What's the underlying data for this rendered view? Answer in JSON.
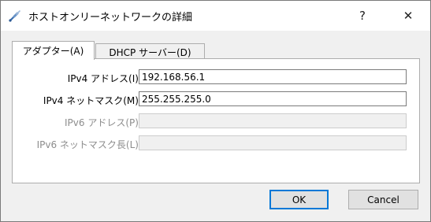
{
  "window": {
    "title": "ホストオンリーネットワークの詳細",
    "help_glyph": "?",
    "close_glyph": "✕",
    "icon": "network-cable-icon"
  },
  "tabs": [
    {
      "label": "アダプター(A)",
      "active": true
    },
    {
      "label": "DHCP サーバー(D)",
      "active": false
    }
  ],
  "fields": {
    "ipv4_address": {
      "label": "IPv4 アドレス(I):",
      "value": "192.168.56.1",
      "enabled": true
    },
    "ipv4_netmask": {
      "label": "IPv4 ネットマスク(M):",
      "value": "255.255.255.0",
      "enabled": true
    },
    "ipv6_address": {
      "label": "IPv6 アドレス(P):",
      "value": "",
      "enabled": false
    },
    "ipv6_prefix": {
      "label": "IPv6 ネットマスク長(L):",
      "value": "",
      "enabled": false
    }
  },
  "buttons": {
    "ok": "OK",
    "cancel": "Cancel"
  },
  "colors": {
    "accent": "#0078d7",
    "disabled_text": "#8d8d8d",
    "face": "#f0f0f0"
  }
}
